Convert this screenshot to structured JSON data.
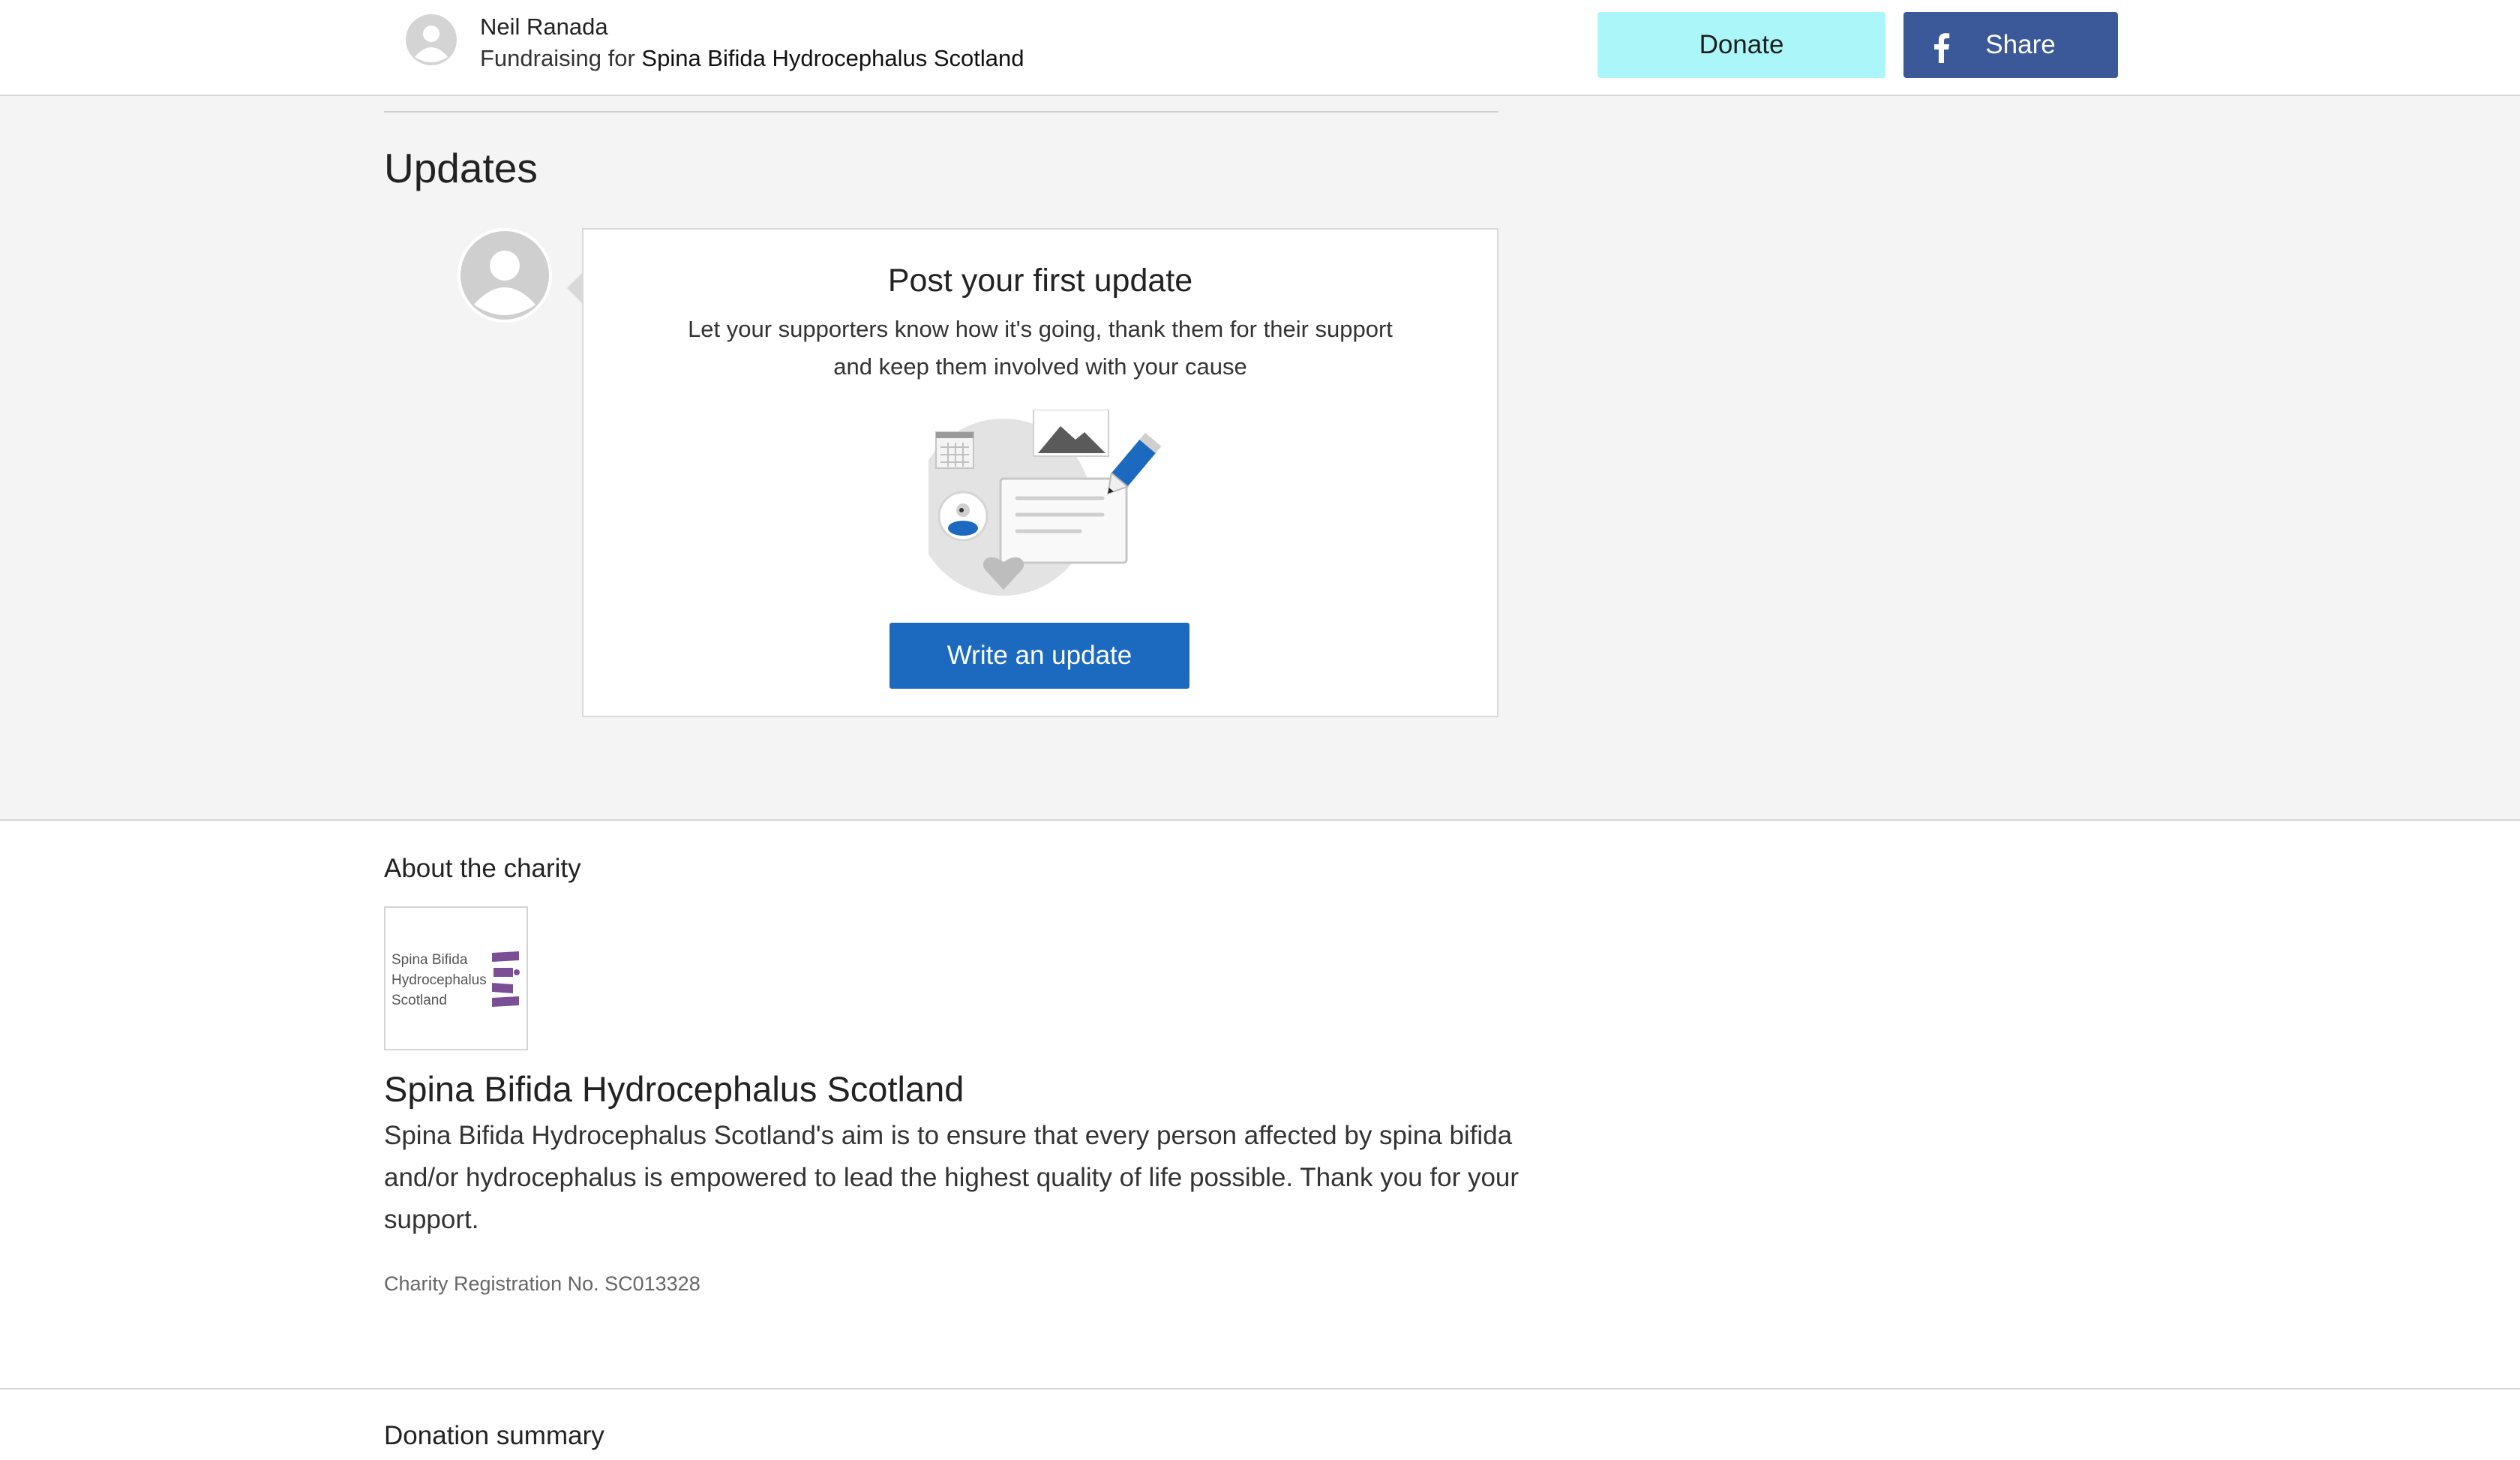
{
  "header": {
    "owner_name": "Neil Ranada",
    "fundraising_prefix": "Fundraising for",
    "charity_name": "Spina Bifida Hydrocephalus Scotland",
    "donate_label": "Donate",
    "share_label": "Share",
    "donate_color": "#aaf6f8",
    "share_color": "#3b5998"
  },
  "updates": {
    "title": "Updates",
    "card": {
      "title": "Post your first update",
      "text_line1": "Let your supporters know how it's going, thank them for their support",
      "text_line2": "and keep them involved with your cause",
      "button_label": "Write an update",
      "button_color": "#1c6ac0"
    }
  },
  "about": {
    "heading": "About the charity",
    "logo_text_line1": "Spina Bifida",
    "logo_text_line2": "Hydrocephalus",
    "logo_text_line3": "Scotland",
    "name": "Spina Bifida Hydrocephalus Scotland",
    "description": "Spina Bifida Hydrocephalus Scotland's aim is to ensure that every person affected by spina bifida and/or hydrocephalus is empowered to lead the highest quality of life possible. Thank you for your support.",
    "registration": "Charity Registration No. SC013328"
  },
  "donation_summary": {
    "heading": "Donation summary"
  }
}
